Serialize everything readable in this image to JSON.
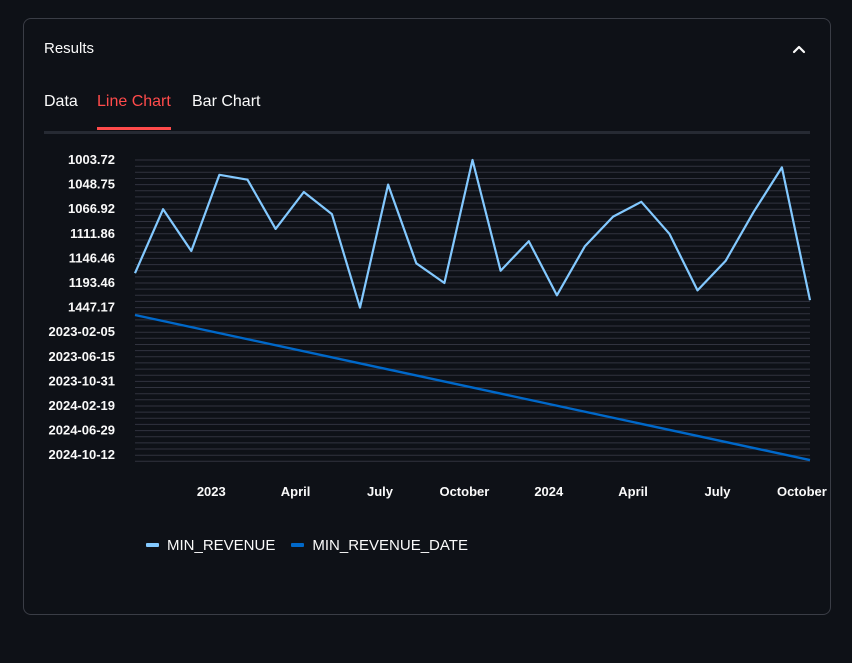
{
  "panel": {
    "title": "Results",
    "collapse_icon": "chevron-up-icon"
  },
  "tabs": [
    {
      "label": "Data",
      "active": false
    },
    {
      "label": "Line Chart",
      "active": true
    },
    {
      "label": "Bar Chart",
      "active": false
    }
  ],
  "colors": {
    "background": "#0e1117",
    "accent": "#ff4b4b",
    "series_min_revenue": "#83c9ff",
    "series_min_revenue_date": "#0068c9",
    "grid": "#31333f"
  },
  "chart_data": {
    "type": "line",
    "title": "",
    "y_tick_labels": [
      "1003.72",
      "1048.75",
      "1066.92",
      "1111.86",
      "1146.46",
      "1193.46",
      "1447.17",
      "2023-02-05",
      "2023-06-15",
      "2023-10-31",
      "2024-02-19",
      "2024-06-29",
      "2024-10-12"
    ],
    "x_tick_labels": [
      "2023",
      "April",
      "July",
      "October",
      "2024",
      "April",
      "July",
      "October"
    ],
    "x_range": [
      "2022-11",
      "2024-11"
    ],
    "x": [
      "2022-11",
      "2022-12",
      "2023-01",
      "2023-02",
      "2023-03",
      "2023-04",
      "2023-05",
      "2023-06",
      "2023-07",
      "2023-08",
      "2023-09",
      "2023-10",
      "2023-11",
      "2023-12",
      "2024-01",
      "2024-02",
      "2024-03",
      "2024-04",
      "2024-05",
      "2024-06",
      "2024-07",
      "2024-08",
      "2024-09",
      "2024-10",
      "2024-11"
    ],
    "y_axis_type": "categorical",
    "grid": true,
    "legend_position": "bottom-left",
    "series": [
      {
        "name": "MIN_REVENUE",
        "y_category_position": [
          4.6,
          2.0,
          3.7,
          0.6,
          0.8,
          2.8,
          1.3,
          2.2,
          6.0,
          1.0,
          4.2,
          5.0,
          0.0,
          4.5,
          3.3,
          5.5,
          3.5,
          2.3,
          1.7,
          3.0,
          5.3,
          4.1,
          2.1,
          0.3,
          5.7
        ]
      },
      {
        "name": "MIN_REVENUE_DATE",
        "trend": "linear decreasing",
        "y_category_position": [
          6.3,
          12.2
        ]
      }
    ]
  },
  "legend": {
    "items": [
      {
        "label": "MIN_REVENUE"
      },
      {
        "label": "MIN_REVENUE_DATE"
      }
    ]
  }
}
